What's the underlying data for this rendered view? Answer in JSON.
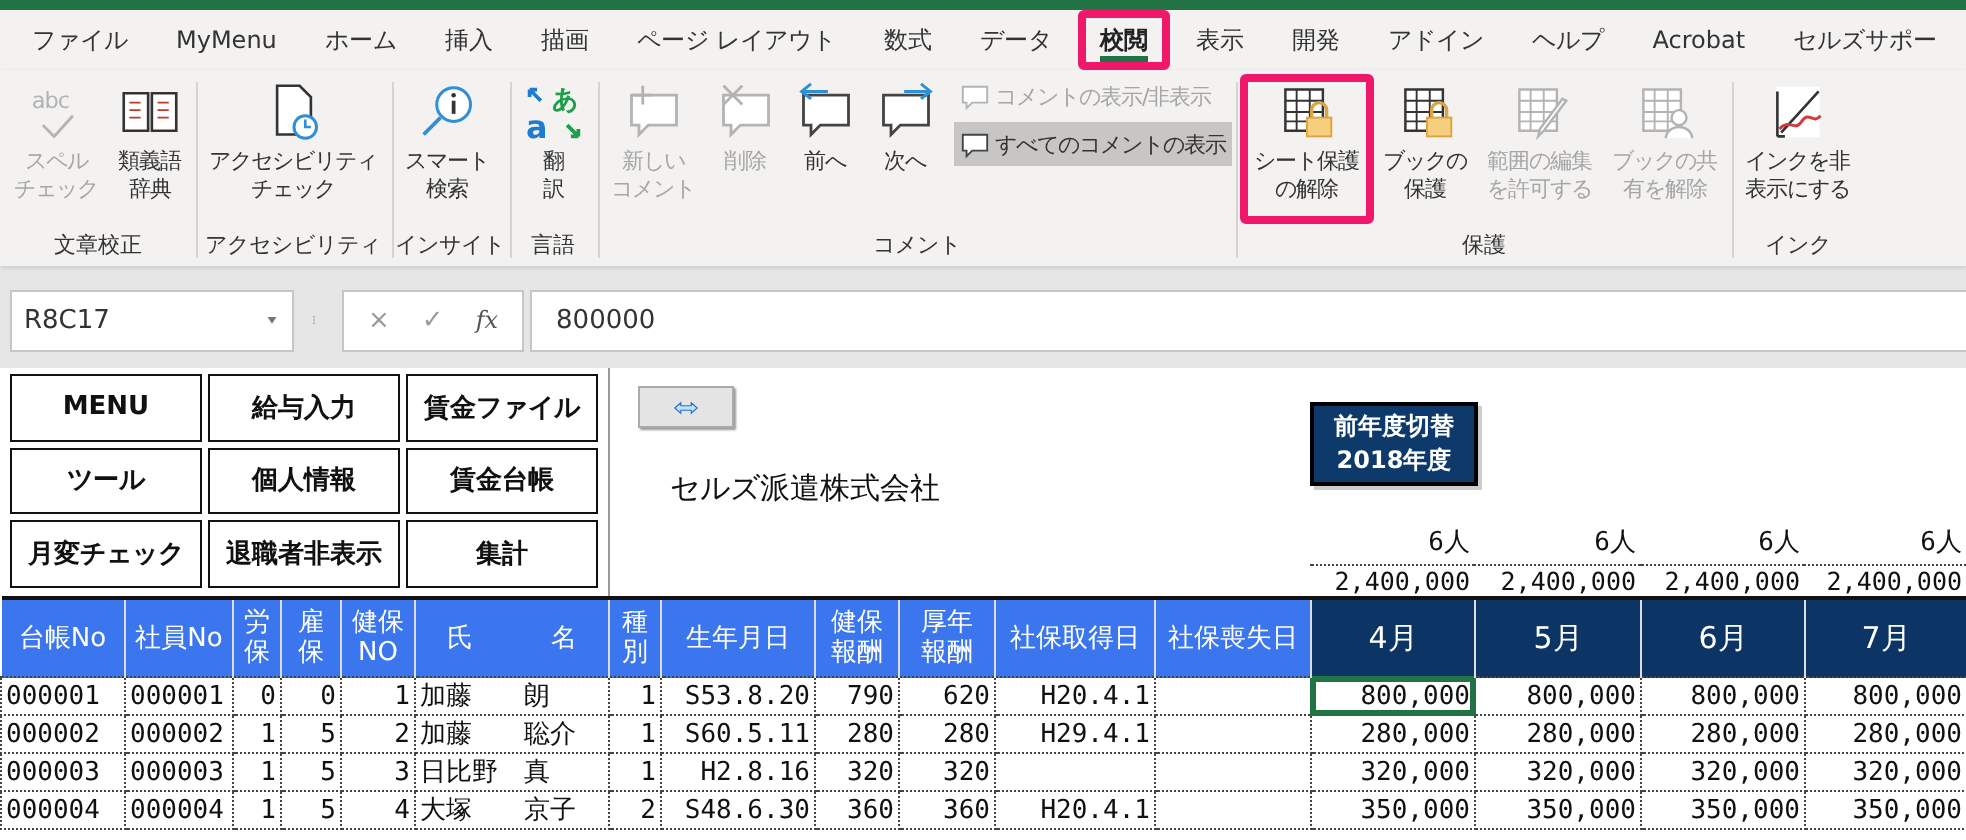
{
  "ribbon_tabs": [
    {
      "label": "ファイル",
      "selected": false,
      "highlighted": false
    },
    {
      "label": "MyMenu",
      "selected": false,
      "highlighted": false
    },
    {
      "label": "ホーム",
      "selected": false,
      "highlighted": false
    },
    {
      "label": "挿入",
      "selected": false,
      "highlighted": false
    },
    {
      "label": "描画",
      "selected": false,
      "highlighted": false
    },
    {
      "label": "ページ レイアウト",
      "selected": false,
      "highlighted": false
    },
    {
      "label": "数式",
      "selected": false,
      "highlighted": false
    },
    {
      "label": "データ",
      "selected": false,
      "highlighted": false
    },
    {
      "label": "校閲",
      "selected": true,
      "highlighted": true
    },
    {
      "label": "表示",
      "selected": false,
      "highlighted": false
    },
    {
      "label": "開発",
      "selected": false,
      "highlighted": false
    },
    {
      "label": "アドイン",
      "selected": false,
      "highlighted": false
    },
    {
      "label": "ヘルプ",
      "selected": false,
      "highlighted": false
    },
    {
      "label": "Acrobat",
      "selected": false,
      "highlighted": false
    },
    {
      "label": "セルズサポー",
      "selected": false,
      "highlighted": false
    }
  ],
  "ribbon_groups": [
    {
      "label": "文章校正",
      "commands": [
        {
          "kind": "large",
          "label": [
            "スペル",
            "チェック"
          ],
          "disabled": true,
          "highlighted": false,
          "icon_text": [
            "abc"
          ]
        },
        {
          "kind": "large",
          "label": [
            "類義語",
            "辞典"
          ],
          "disabled": false,
          "highlighted": false
        }
      ]
    },
    {
      "label": "アクセシビリティ",
      "commands": [
        {
          "kind": "large",
          "label": [
            "アクセシビリティ",
            "チェック"
          ],
          "disabled": false,
          "highlighted": false
        }
      ]
    },
    {
      "label": "インサイト",
      "commands": [
        {
          "kind": "large",
          "label": [
            "スマート",
            "検索"
          ],
          "disabled": false,
          "highlighted": false
        }
      ]
    },
    {
      "label": "言語",
      "commands": [
        {
          "kind": "large",
          "label": [
            "翻",
            "訳"
          ],
          "disabled": false,
          "highlighted": false,
          "icon_text": [
            "あ",
            "a"
          ]
        }
      ]
    },
    {
      "label": "コメント",
      "commands": [
        {
          "kind": "large",
          "label": [
            "新しい",
            "コメント"
          ],
          "disabled": true,
          "highlighted": false
        },
        {
          "kind": "large",
          "label": [
            "削除"
          ],
          "disabled": true,
          "highlighted": false
        },
        {
          "kind": "large",
          "label": [
            "前へ"
          ],
          "disabled": false,
          "highlighted": false
        },
        {
          "kind": "large",
          "label": [
            "次へ"
          ],
          "disabled": false,
          "highlighted": false
        },
        {
          "kind": "small",
          "label": "コメントの表示/非表示",
          "disabled": true,
          "pressed": false
        },
        {
          "kind": "small",
          "label": "すべてのコメントの表示",
          "disabled": false,
          "pressed": true
        }
      ]
    },
    {
      "label": "保護",
      "commands": [
        {
          "kind": "large",
          "label": [
            "シート保護",
            "の解除"
          ],
          "disabled": false,
          "highlighted": true
        },
        {
          "kind": "large",
          "label": [
            "ブックの",
            "保護"
          ],
          "disabled": false,
          "highlighted": false
        },
        {
          "kind": "large",
          "label": [
            "範囲の編集",
            "を許可する"
          ],
          "disabled": true,
          "highlighted": false
        },
        {
          "kind": "large",
          "label": [
            "ブックの共",
            "有を解除"
          ],
          "disabled": true,
          "highlighted": false
        }
      ]
    },
    {
      "label": "インク",
      "commands": [
        {
          "kind": "large",
          "label": [
            "インクを非",
            "表示にする"
          ],
          "disabled": false,
          "highlighted": false
        }
      ]
    }
  ],
  "formula_bar": {
    "name_box": "R8C17",
    "cancel": "×",
    "enter": "✓",
    "function_label": "fx",
    "value": "800000"
  },
  "sheet": {
    "macro_buttons": [
      "MENU",
      "給与入力",
      "賃金ファイル",
      "ツール",
      "個人情報",
      "賃金台帳",
      "月変チェック",
      "退職者非表示",
      "集計"
    ],
    "company_name": "セルズ派遣株式会社",
    "year_switch_button": [
      "前年度切替",
      "2018年度"
    ],
    "headcounts": [
      "6人",
      "6人",
      "6人",
      "6人"
    ],
    "totals": [
      "2,400,000",
      "2,400,000",
      "2,400,000",
      "2,400,000"
    ],
    "table": {
      "columns": [
        {
          "label": [
            "台帳No"
          ],
          "kind": "info"
        },
        {
          "label": [
            "社員No"
          ],
          "kind": "info"
        },
        {
          "label": [
            "労",
            "保"
          ],
          "kind": "info"
        },
        {
          "label": [
            "雇",
            "保"
          ],
          "kind": "info"
        },
        {
          "label": [
            "健保",
            "NO"
          ],
          "kind": "info"
        },
        {
          "label": [
            "氏　　　名"
          ],
          "kind": "info"
        },
        {
          "label": [
            "種",
            "別"
          ],
          "kind": "info"
        },
        {
          "label": [
            "生年月日"
          ],
          "kind": "info"
        },
        {
          "label": [
            "健保",
            "報酬"
          ],
          "kind": "info"
        },
        {
          "label": [
            "厚年",
            "報酬"
          ],
          "kind": "info"
        },
        {
          "label": [
            "社保取得日"
          ],
          "kind": "info"
        },
        {
          "label": [
            "社保喪失日"
          ],
          "kind": "info"
        },
        {
          "label": [
            "4月"
          ],
          "kind": "month"
        },
        {
          "label": [
            "5月"
          ],
          "kind": "month"
        },
        {
          "label": [
            "6月"
          ],
          "kind": "month"
        },
        {
          "label": [
            "7月"
          ],
          "kind": "month"
        }
      ],
      "rows": [
        {
          "cells": [
            "000001",
            "000001",
            "0",
            "0",
            "1",
            "加藤　　朗",
            "1",
            "S53.8.20",
            "790",
            "620",
            "H20.4.1",
            null
          ],
          "months": [
            {
              "value": "800,000",
              "selected": true
            },
            {
              "value": "800,000",
              "selected": false
            },
            {
              "value": "800,000",
              "selected": false
            },
            {
              "value": "800,000",
              "selected": false
            }
          ]
        },
        {
          "cells": [
            "000002",
            "000002",
            "1",
            "5",
            "2",
            "加藤　　聡介",
            "1",
            "S60.5.11",
            "280",
            "280",
            "H29.4.1",
            null
          ],
          "months": [
            {
              "value": "280,000",
              "selected": false
            },
            {
              "value": "280,000",
              "selected": false
            },
            {
              "value": "280,000",
              "selected": false
            },
            {
              "value": "280,000",
              "selected": false
            }
          ]
        },
        {
          "cells": [
            "000003",
            "000003",
            "1",
            "5",
            "3",
            "日比野　真",
            "1",
            "H2.8.16",
            "320",
            "320",
            null,
            null
          ],
          "months": [
            {
              "value": "320,000",
              "selected": false
            },
            {
              "value": "320,000",
              "selected": false
            },
            {
              "value": "320,000",
              "selected": false
            },
            {
              "value": "320,000",
              "selected": false
            }
          ]
        },
        {
          "cells": [
            "000004",
            "000004",
            "1",
            "5",
            "4",
            "大塚　　京子",
            "2",
            "S48.6.30",
            "360",
            "360",
            "H20.4.1",
            null
          ],
          "months": [
            {
              "value": "350,000",
              "selected": false
            },
            {
              "value": "350,000",
              "selected": false
            },
            {
              "value": "350,000",
              "selected": false
            },
            {
              "value": "350,000",
              "selected": false
            }
          ]
        }
      ]
    }
  }
}
